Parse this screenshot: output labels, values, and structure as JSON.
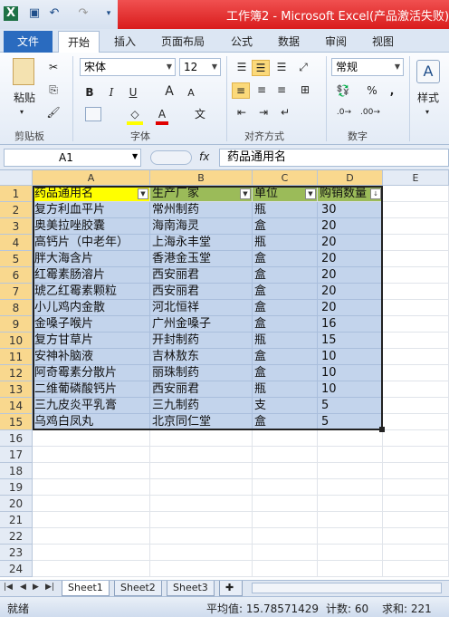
{
  "window": {
    "title": "工作簿2 - Microsoft Excel(产品激活失败)"
  },
  "ribbon_tabs": {
    "file": "文件",
    "tabs": [
      "开始",
      "插入",
      "页面布局",
      "公式",
      "数据",
      "审阅",
      "视图"
    ],
    "active": "开始"
  },
  "ribbon": {
    "paste_label": "粘贴",
    "clipboard_label": "剪贴板",
    "font_name": "宋体",
    "font_size": "12",
    "font_group_label": "字体",
    "align_group_label": "对齐方式",
    "number_format": "常规",
    "number_group_label": "数字",
    "styles_label": "样式",
    "bold": "B",
    "italic": "I",
    "underline": "U",
    "grow_font": "A",
    "shrink_font": "A",
    "percent": "%",
    "comma": ","
  },
  "formula_bar": {
    "name_box": "A1",
    "fx": "fx",
    "content": "药品通用名"
  },
  "columns": [
    "A",
    "B",
    "C",
    "D",
    "E"
  ],
  "rows": [
    "1",
    "2",
    "3",
    "4",
    "5",
    "6",
    "7",
    "8",
    "9",
    "10",
    "11",
    "12",
    "13",
    "14",
    "15",
    "16",
    "17",
    "18",
    "19",
    "20",
    "21",
    "22",
    "23",
    "24"
  ],
  "table": {
    "headers": [
      "药品通用名",
      "生产厂家",
      "单位",
      "购销数量"
    ],
    "data": [
      [
        "复方利血平片",
        "常州制药",
        "瓶",
        "30"
      ],
      [
        "奥美拉唑胶囊",
        "海南海灵",
        "盒",
        "20"
      ],
      [
        "高钙片（中老年）",
        "上海永丰堂",
        "瓶",
        "20"
      ],
      [
        "胖大海含片",
        "香港金玉堂",
        "盒",
        "20"
      ],
      [
        "红霉素肠溶片",
        "西安丽君",
        "盒",
        "20"
      ],
      [
        "琥乙红霉素颗粒",
        "西安丽君",
        "盒",
        "20"
      ],
      [
        "小儿鸡内金散",
        "河北恒祥",
        "盒",
        "20"
      ],
      [
        "金嗓子喉片",
        "广州金嗓子",
        "盒",
        "16"
      ],
      [
        "复方甘草片",
        "开封制药",
        "瓶",
        "15"
      ],
      [
        "安神补脑液",
        "吉林敖东",
        "盒",
        "10"
      ],
      [
        "阿奇霉素分散片",
        "丽珠制药",
        "盒",
        "10"
      ],
      [
        "二维葡磷酸钙片",
        "西安丽君",
        "瓶",
        "10"
      ],
      [
        "三九皮炎平乳膏",
        "三九制药",
        "支",
        "5"
      ],
      [
        "乌鸡白凤丸",
        "北京同仁堂",
        "盒",
        "5"
      ]
    ]
  },
  "sheet_tabs": [
    "Sheet1",
    "Sheet2",
    "Sheet3"
  ],
  "active_sheet": "Sheet1",
  "status": {
    "ready": "就绪",
    "average": "平均值: 15.78571429",
    "count": "计数: 60",
    "sum": "求和: 221"
  }
}
